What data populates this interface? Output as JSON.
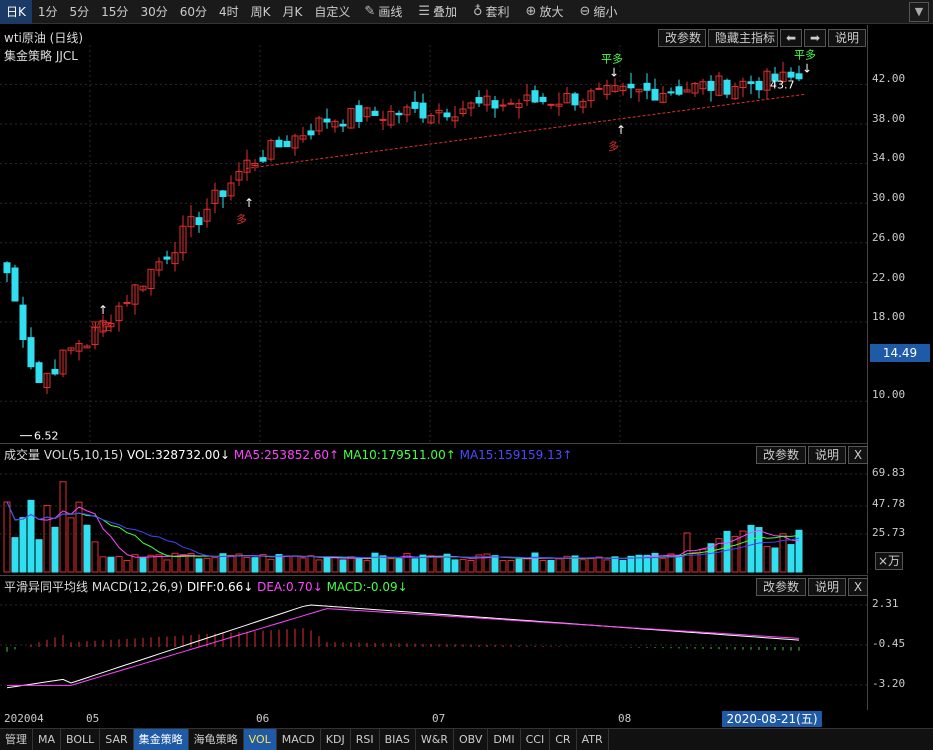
{
  "toolbar": {
    "periods": [
      "日K",
      "1分",
      "5分",
      "15分",
      "30分",
      "60分",
      "4时",
      "周K",
      "月K",
      "自定义"
    ],
    "tools": [
      {
        "icon": "pencil-icon",
        "label": "画线"
      },
      {
        "icon": "stack-icon",
        "label": "叠加"
      },
      {
        "icon": "money-bag-icon",
        "label": "套利"
      },
      {
        "icon": "zoom-in-icon",
        "label": "放大"
      },
      {
        "icon": "zoom-out-icon",
        "label": "缩小"
      }
    ]
  },
  "main": {
    "title": "wti原油 (日线)",
    "strategy": "集金策略  JJCL",
    "buttons": {
      "params": "改参数",
      "hide": "隐藏主指标",
      "left": "⬅",
      "right": "➡",
      "help": "说明"
    },
    "y_ticks": [
      "42.00",
      "38.00",
      "34.00",
      "30.00",
      "26.00",
      "22.00",
      "18.00",
      "14.49",
      "10.00"
    ],
    "current_price": "14.49",
    "low_label": "6.52",
    "high_label": "43.7",
    "signals": [
      "平空",
      "多",
      "平多",
      "多",
      "平多"
    ]
  },
  "volume": {
    "title": "成交量",
    "params": "VOL(5,10,15)",
    "vol": "VOL:328732.00↓",
    "ma5": "MA5:253852.60↑",
    "ma10": "MA10:179511.00↑",
    "ma15": "MA15:159159.13↑",
    "y_ticks": [
      "69.83",
      "47.78",
      "25.73"
    ],
    "unit": "×万",
    "buttons": {
      "params": "改参数",
      "help": "说明",
      "close": "X"
    }
  },
  "macd": {
    "title": "平滑异同平均线",
    "params": "MACD(12,26,9)",
    "diff": "DIFF:0.66↓",
    "dea": "DEA:0.70↓",
    "macd": "MACD:-0.09↓",
    "y_ticks": [
      "2.31",
      "-0.45",
      "-3.20"
    ],
    "buttons": {
      "params": "改参数",
      "help": "说明",
      "close": "X"
    }
  },
  "date_axis": {
    "labels": [
      "202004",
      "05",
      "06",
      "07",
      "08"
    ],
    "selected": "2020-08-21(五)"
  },
  "bottom_tabs": [
    "管理",
    "MA",
    "BOLL",
    "SAR",
    "集金策略",
    "海龟策略",
    "VOL",
    "MACD",
    "KDJ",
    "RSI",
    "BIAS",
    "W&R",
    "OBV",
    "DMI",
    "CCI",
    "CR",
    "ATR"
  ],
  "colors": {
    "up": "#e03030",
    "down": "#30e0f0",
    "accent": "#1f5aa6",
    "ma5": "#ff44ff",
    "ma10": "#44ff44",
    "ma15": "#4444ff"
  }
}
